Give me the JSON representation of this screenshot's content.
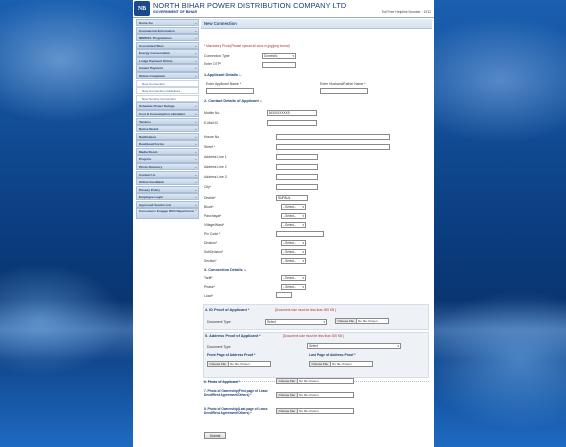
{
  "header": {
    "logo_text": "NB",
    "company_name": "NORTH BIHAR POWER DISTRIBUTION COMPANY LTD",
    "subtitle": "GOVERNMENT OF BIHAR",
    "helpline": "Toll Free Helpline Number : 1912"
  },
  "sidebar": {
    "items": [
      {
        "label": "Home Go"
      },
      {
        "label": "Commercial Information"
      },
      {
        "label": "NBPDCL Programmes"
      },
      {
        "label": "Associated Sites"
      },
      {
        "label": "Energy Conservation"
      },
      {
        "label": "Lodge Payment Online"
      },
      {
        "label": "Instant Payment"
      },
      {
        "label": "Online Complaint"
      },
      {
        "label": "New Connection",
        "sub": true
      },
      {
        "label": "New Connection Guidelines",
        "sub": true
      },
      {
        "label": "New Service Connection",
        "sub": true
      },
      {
        "label": "Schedule Power Outage"
      },
      {
        "label": "Cost & Consumption calculator"
      },
      {
        "label": "Tenders"
      },
      {
        "label": "Notice Board"
      },
      {
        "label": "Notification"
      },
      {
        "label": "Download Forms"
      },
      {
        "label": "Media Room"
      },
      {
        "label": "Projects"
      },
      {
        "label": "Photo Directory"
      },
      {
        "label": "Contact Us"
      },
      {
        "label": "Online Feedback"
      },
      {
        "label": "Privacy Policy"
      },
      {
        "label": "Employee Login"
      },
      {
        "label": "Approved Vendor List"
      },
      {
        "label": "Consumers Engage With Department",
        "tall": true
      }
    ]
  },
  "form": {
    "title": "New Connection",
    "mandatory_note": "* Mandatory Photo(Please upload all docs in jpg/jpeg format)",
    "connection_type_label": "Connection Type:",
    "connection_type_value": "Domestic",
    "enter_otp_label": "Enter OTP*",
    "otp_value": "",
    "sec1": "1.Applicant Details :-",
    "applicant_name_label": "Enter Applicant Name *",
    "father_name_label": "Enter Husband/Father Name *",
    "sec2": "2. Contact Details of Applicant :-",
    "mobile_label": "Mobile No.",
    "mobile_value": "8XXXXXXXX9",
    "email_label": "E-Mail ID",
    "house_label": "House No",
    "street_label": "Street *",
    "addr1_label": "Address Line 1",
    "addr2_label": "Address Line 2",
    "addr3_label": "Address Line 3",
    "city_label": "City*",
    "district_label": "District*",
    "district_value": "SUPAUL",
    "block_label": "Block*",
    "panchayat_label": "Panchayat*",
    "village_label": "Village/Ward*",
    "pincode_label": "Pin Code *",
    "division_label": "Division*",
    "subdivision_label": "SubDivision*",
    "section_label": "Section*",
    "select_placeholder": "--Select--",
    "sec3": "3. Connection Details :-",
    "tariff_label": "Tariff*",
    "phase_label": "Phase*",
    "load_label": "Load*",
    "sec4": "4. ID Proof of Applicant *",
    "sec4_hint": "[Document size must be less than 300 KB ]",
    "doc_type_label": "Document Type",
    "id_doc_value": "Select",
    "choose_file": "Choose File",
    "no_file": "No file chosen",
    "sec5": "5. Address Proof of Applicant *",
    "sec5_hint": "[Document size must be less than 300 KB ]",
    "addr_doc_value": "Select",
    "front_label": "Front Page of Address Proof *",
    "last_label": "Last Page of Address Proof *",
    "sec6": "6. Photo of Applicant *",
    "sec7": "7. Photo of Ownership(First page of Lease Deed/Rent Agreement/Others) *",
    "sec8": "8. Photo of Ownership(Last page of Lease Deed/Rent Agreement/Others) *",
    "submit": "Submit"
  }
}
